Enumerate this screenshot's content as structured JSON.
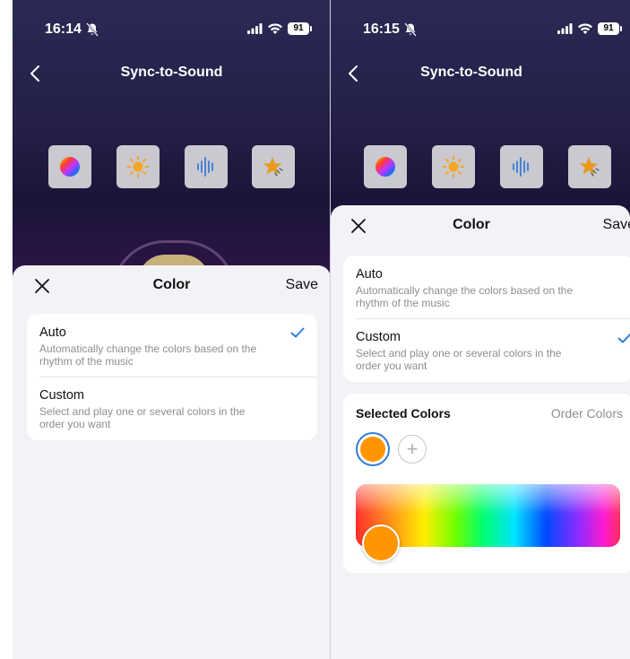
{
  "colors": {
    "accent": "#2f7ed8",
    "selected_color": "#ff9500",
    "icon_blue": "#3a7bd5",
    "icon_orange": "#f5a623"
  },
  "phone1": {
    "status": {
      "time": "16:14",
      "battery": "91"
    },
    "nav": {
      "back_icon": "chevron-left-icon",
      "title": "Sync-to-Sound"
    },
    "modes": [
      "color-wheel-icon",
      "sun-icon",
      "sound-wave-icon",
      "star-icon"
    ],
    "sheet": {
      "close_icon": "close-icon",
      "title": "Color",
      "save_label": "Save",
      "options": [
        {
          "title": "Auto",
          "desc": "Automatically change the colors based on the rhythm of the music",
          "checked": true
        },
        {
          "title": "Custom",
          "desc": "Select and play one or several colors in the order you want",
          "checked": false
        }
      ]
    }
  },
  "phone2": {
    "status": {
      "time": "16:15",
      "battery": "91"
    },
    "nav": {
      "back_icon": "chevron-left-icon",
      "title": "Sync-to-Sound"
    },
    "modes": [
      "color-wheel-icon",
      "sun-icon",
      "sound-wave-icon",
      "star-icon"
    ],
    "sheet": {
      "close_icon": "close-icon",
      "title": "Color",
      "save_label": "Save",
      "options": [
        {
          "title": "Auto",
          "desc": "Automatically change the colors based on the rhythm of the music",
          "checked": false
        },
        {
          "title": "Custom",
          "desc": "Select and play one or several colors in the order you want",
          "checked": true
        }
      ],
      "selected_colors_title": "Selected Colors",
      "order_colors_label": "Order Colors",
      "add_color_symbol": "+"
    }
  }
}
